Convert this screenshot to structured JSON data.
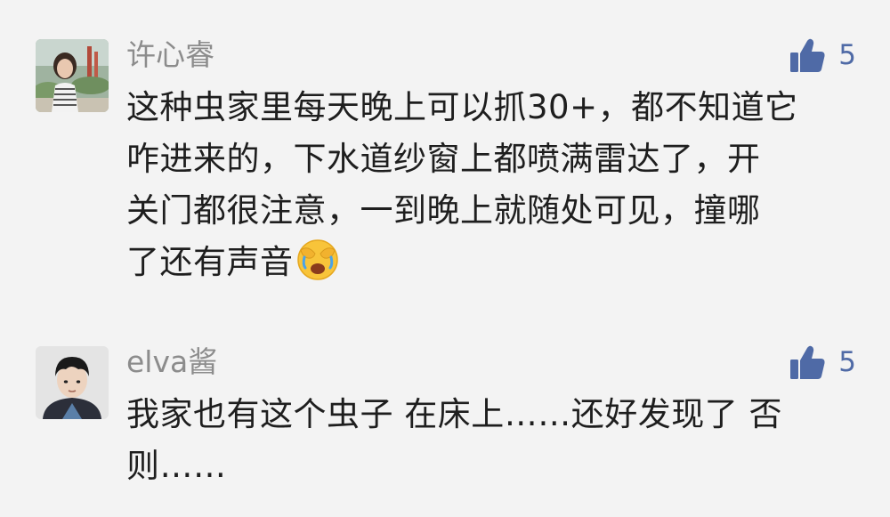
{
  "comments": [
    {
      "username": "许心睿",
      "avatar_icon": "user-avatar-girl-outdoor",
      "like_icon": "thumbs-up-icon",
      "likes": "5",
      "lines": [
        "这种虫家里每天晚上可以抓30+，都不知道它",
        "咋进来的，下水道纱窗上都喷满雷达了，开",
        "关门都很注意，一到晚上就随处可见，撞哪",
        "了还有声音"
      ],
      "emoji": "face-with-hand-over-eyes-crying-emoji"
    },
    {
      "username": "elva酱",
      "avatar_icon": "user-avatar-boy",
      "like_icon": "thumbs-up-icon",
      "likes": "5",
      "lines": [
        "我家也有这个虫子 在床上……还好发现了 否",
        "则……"
      ]
    }
  ],
  "colors": {
    "background": "#f3f3f3",
    "username": "#8c8c8c",
    "like_accent": "#4f6aa6",
    "text": "#1e1e1e"
  }
}
